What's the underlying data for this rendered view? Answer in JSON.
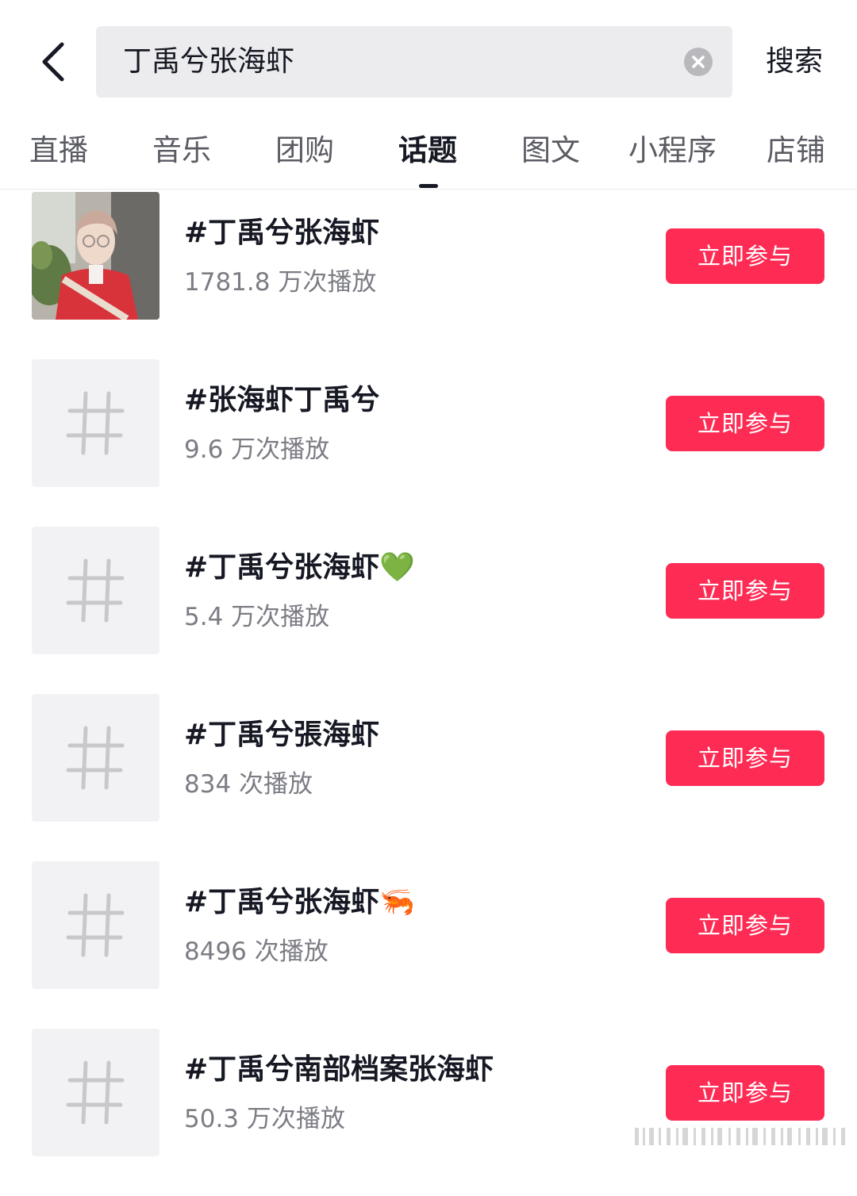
{
  "search": {
    "query": "丁禹兮张海虾",
    "button_label": "搜索"
  },
  "tabs": [
    {
      "label": "直播"
    },
    {
      "label": "音乐"
    },
    {
      "label": "团购"
    },
    {
      "label": "话题",
      "active": true
    },
    {
      "label": "图文"
    },
    {
      "label": "小程序"
    },
    {
      "label": "店铺"
    }
  ],
  "topics": [
    {
      "title": "#丁禹兮张海虾",
      "plays": "1781.8 万次播放",
      "join_label": "立即参与",
      "thumb": "photo"
    },
    {
      "title": "#张海虾丁禹兮",
      "plays": "9.6 万次播放",
      "join_label": "立即参与",
      "thumb": "hashtag-icon"
    },
    {
      "title": "#丁禹兮张海虾💚",
      "plays": "5.4 万次播放",
      "join_label": "立即参与",
      "thumb": "hashtag-icon"
    },
    {
      "title": "#丁禹兮張海虾",
      "plays": "834 次播放",
      "join_label": "立即参与",
      "thumb": "hashtag-icon"
    },
    {
      "title": "#丁禹兮张海虾🦐",
      "plays": "8496 次播放",
      "join_label": "立即参与",
      "thumb": "hashtag-icon"
    },
    {
      "title": "#丁禹兮南部档案张海虾",
      "plays": "50.3 万次播放",
      "join_label": "立即参与",
      "thumb": "hashtag-icon"
    }
  ],
  "colors": {
    "accent": "#fe2c55",
    "text_primary": "#161823",
    "text_secondary": "#7c7d84",
    "search_bg": "#ececee"
  }
}
